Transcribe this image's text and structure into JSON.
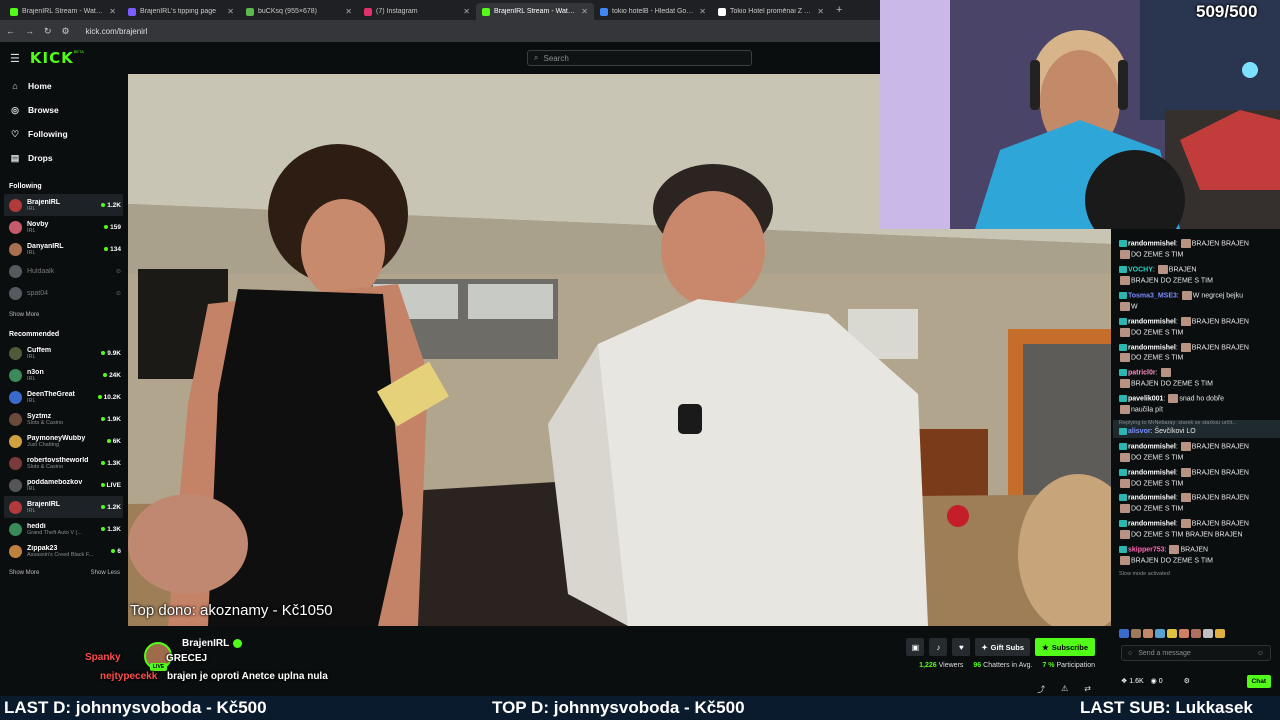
{
  "browser": {
    "tabs": [
      {
        "title": "BrajenIRL Stream - Watch Live",
        "color": "#53fc18",
        "active": false
      },
      {
        "title": "BrajenIRL's tipping page",
        "color": "#7b5cff",
        "active": false
      },
      {
        "title": "buCKsq (955×678)",
        "color": "#5fb84f",
        "active": false
      },
      {
        "title": "(7) Instagram",
        "color": "#e1306c",
        "active": false
      },
      {
        "title": "BrajenIRL Stream - Watch Live",
        "color": "#53fc18",
        "active": true
      },
      {
        "title": "tokio hotelB - Hledat Googlem",
        "color": "#4285f4",
        "active": false
      },
      {
        "title": "Tokio Hotel proměnai Z Bila je",
        "color": "#ffffff",
        "active": false
      }
    ],
    "url": "kick.com/brajenirl"
  },
  "app": {
    "logo": "KICK",
    "logo_sup": "BETA",
    "search_placeholder": "Search"
  },
  "nav": [
    {
      "label": "Home",
      "icon": "home-icon",
      "glyph": "⌂"
    },
    {
      "label": "Browse",
      "icon": "compass-icon",
      "glyph": "◎"
    },
    {
      "label": "Following",
      "icon": "heart-icon",
      "glyph": "♡"
    },
    {
      "label": "Drops",
      "icon": "drops-icon",
      "glyph": "▤"
    }
  ],
  "following": {
    "title": "Following",
    "show_more": "Show More",
    "channels": [
      {
        "name": "BrajenIRL",
        "category": "IRL",
        "viewers": "1.2K",
        "live": true,
        "selected": true,
        "color": "#b13a3a"
      },
      {
        "name": "Novby",
        "category": "IRL",
        "viewers": "159",
        "live": true,
        "selected": false,
        "color": "#c75a6a"
      },
      {
        "name": "DanyanIRL",
        "category": "IRL",
        "viewers": "134",
        "live": true,
        "selected": false,
        "color": "#a87050"
      },
      {
        "name": "Huldaalk",
        "category": "",
        "viewers": "",
        "live": false,
        "selected": false,
        "color": "#555a5e"
      },
      {
        "name": "spat04",
        "category": "",
        "viewers": "",
        "live": false,
        "selected": false,
        "color": "#555a5e"
      }
    ]
  },
  "recommended": {
    "title": "Recommended",
    "show_more": "Show More",
    "show_less": "Show Less",
    "channels": [
      {
        "name": "Cuffem",
        "category": "IRL",
        "viewers": "9.9K",
        "color": "#4f5a3a"
      },
      {
        "name": "n3on",
        "category": "IRL",
        "viewers": "24K",
        "color": "#3a8a5a"
      },
      {
        "name": "DeenTheGreat",
        "category": "IRL",
        "viewers": "10.2K",
        "color": "#3a6acc"
      },
      {
        "name": "Syztmz",
        "category": "Slots & Casino",
        "viewers": "1.9K",
        "color": "#6a4a3a"
      },
      {
        "name": "PaymoneyWubby",
        "category": "Just Chatting",
        "viewers": "6K",
        "color": "#d0a040"
      },
      {
        "name": "robertovstheworld",
        "category": "Slots & Casino",
        "viewers": "1.3K",
        "color": "#7a3a3a"
      },
      {
        "name": "poddamebozkov",
        "category": "IRL",
        "viewers": "LIVE",
        "color": "#555"
      },
      {
        "name": "BrajenIRL",
        "category": "IRL",
        "viewers": "1.2K",
        "color": "#b13a3a"
      },
      {
        "name": "heddi",
        "category": "Grand Theft Auto V (...",
        "viewers": "1.3K",
        "color": "#3a8a5a"
      },
      {
        "name": "Zippak23",
        "category": "Assassin's Creed Black F...",
        "viewers": "6",
        "color": "#c08040"
      }
    ]
  },
  "video": {
    "top_dono": "Top dono: akoznamy - Kč1050"
  },
  "overlay": {
    "counter": "509/500",
    "chat_line1_user": "Spanky",
    "chat_line1_text": "GRECEJ",
    "chat_line2_user": "nejtypecekk",
    "chat_line2_text": "brajen je oproti Anetce uplna nula",
    "bottom_left": "LAST D: johnnysvoboda - Kč500",
    "bottom_center": "TOP D: johnnysvoboda - Kč500",
    "bottom_right": "LAST SUB: Lukkasek"
  },
  "streamer": {
    "name": "BrajenIRL",
    "live": "LIVE",
    "gift_subs": "Gift Subs",
    "subscribe": "Subscribe",
    "viewers": "1,226",
    "viewers_label": "Viewers",
    "chatters": "96",
    "chatters_label": "Chatters in Avg.",
    "participation": "7 %",
    "participation_label": "Participation"
  },
  "chat": {
    "messages": [
      {
        "user": "randommishel",
        "color": "#ffffff",
        "text": "BRAJEN BRAJEN",
        "line2": "DO ZEME S TIM"
      },
      {
        "user": "VOCHY",
        "color": "#2bd5c9",
        "text": "BRAJEN",
        "line2": "BRAJEN DO ZEME S TIM"
      },
      {
        "user": "Tosma3_MSE3",
        "color": "#7b8cff",
        "text": "W negrcej bejku",
        "line2": "W"
      },
      {
        "user": "randommishel",
        "color": "#ffffff",
        "text": "BRAJEN BRAJEN",
        "line2": "DO ZEME S TIM"
      },
      {
        "user": "randommishel",
        "color": "#ffffff",
        "text": "BRAJEN BRAJEN",
        "line2": "DO ZEME S TIM"
      },
      {
        "user": "patricl0r",
        "color": "#ff8cc6",
        "text": "",
        "line2": "BRAJEN DO ZEME S TIM"
      },
      {
        "user": "pavelik001",
        "color": "#ffffff",
        "text": "snad ho dobře",
        "line2": "naučila pít"
      }
    ],
    "reply_to": "Replying to MrNebaray: starek se starkou určit...",
    "reply_user": "alisvor",
    "reply_text": "Ševčíkovi LO",
    "messages2": [
      {
        "user": "randommishel",
        "color": "#ffffff",
        "text": "BRAJEN BRAJEN",
        "line2": "DO ZEME S TIM"
      },
      {
        "user": "randommishel",
        "color": "#ffffff",
        "text": "BRAJEN BRAJEN",
        "line2": "DO ZEME S TIM"
      },
      {
        "user": "randommishel",
        "color": "#ffffff",
        "text": "BRAJEN BRAJEN",
        "line2": "DO ZEME S TIM"
      },
      {
        "user": "randommishel",
        "color": "#ffffff",
        "text": "BRAJEN BRAJEN",
        "line2": "DO ZEME S TIM BRAJEN BRAJEN"
      },
      {
        "user": "skipper753",
        "color": "#ff69b4",
        "text": "BRAJEN",
        "line2": "BRAJEN DO ZEME S TIM"
      }
    ],
    "slow_mode": "Slow mode activated",
    "input_placeholder": "Send a message",
    "points": "1.6K",
    "kicks": "0",
    "chat_button": "Chat"
  }
}
